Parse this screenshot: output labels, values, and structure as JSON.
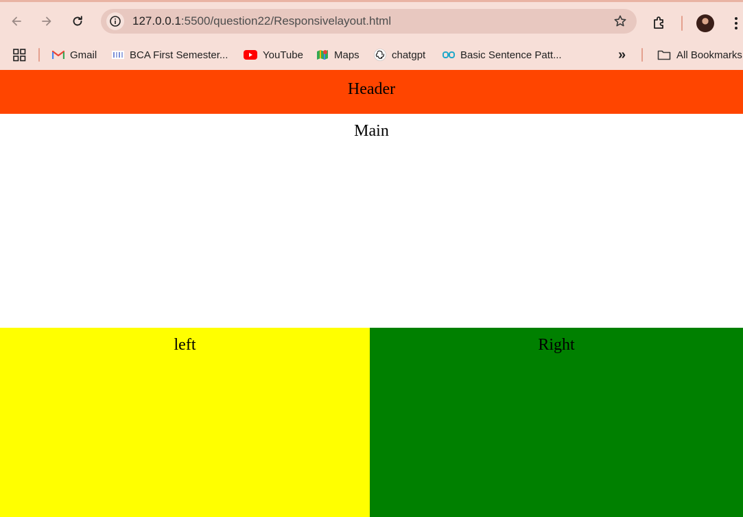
{
  "browser": {
    "address": {
      "host": "127.0.0.1",
      "path": ":5500/question22/Responsivelayout.html"
    },
    "bookmarks": [
      {
        "label": "Gmail",
        "icon": "gmail-icon"
      },
      {
        "label": "BCA First Semester...",
        "icon": "bca-favicon"
      },
      {
        "label": "YouTube",
        "icon": "youtube-icon"
      },
      {
        "label": "Maps",
        "icon": "maps-icon"
      },
      {
        "label": "chatgpt",
        "icon": "chatgpt-icon"
      },
      {
        "label": "Basic Sentence Patt...",
        "icon": "glasses-icon"
      }
    ],
    "overflow_label": "»",
    "all_bookmarks_label": "All Bookmarks"
  },
  "page": {
    "header": "Header",
    "main": "Main",
    "left": "left",
    "right": "Right",
    "colors": {
      "header": "#ff4500",
      "main": "#ffffff",
      "left": "#ffff00",
      "right": "#008000"
    }
  }
}
